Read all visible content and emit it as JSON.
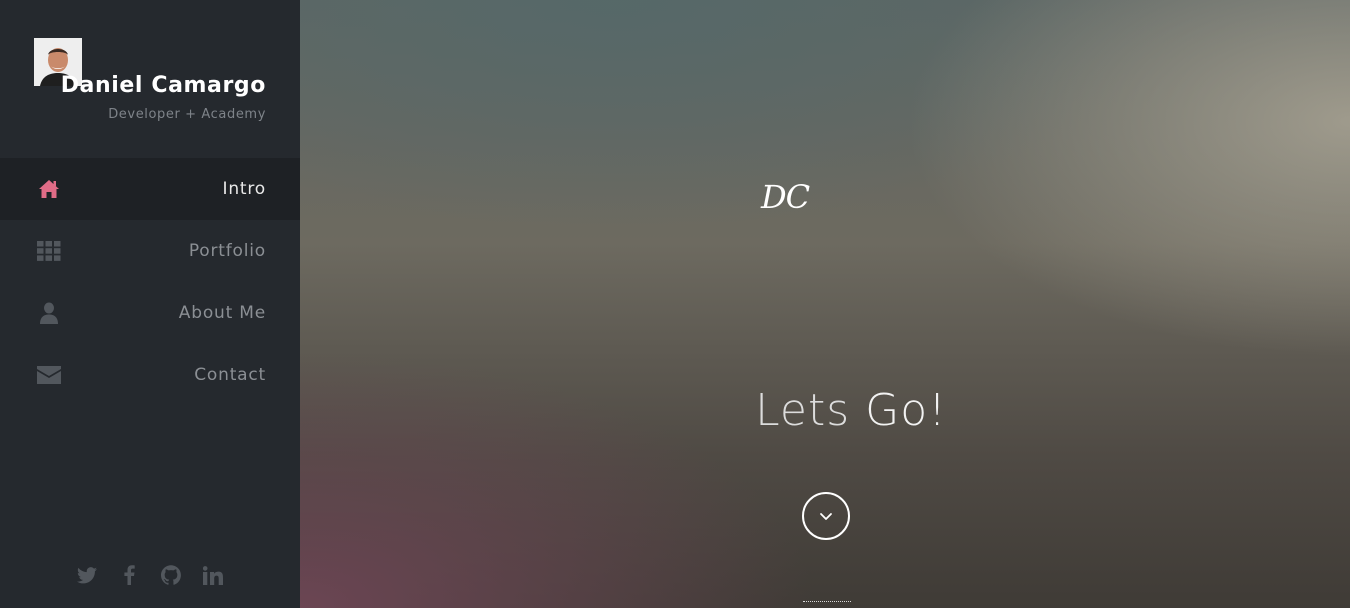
{
  "profile": {
    "name": "Daniel Camargo",
    "subtitle": "Developer + Academy",
    "avatar_icon": "person-photo"
  },
  "nav": {
    "items": [
      {
        "label": "Intro",
        "icon": "home-icon",
        "active": true
      },
      {
        "label": "Portfolio",
        "icon": "grid-icon",
        "active": false
      },
      {
        "label": "About Me",
        "icon": "user-icon",
        "active": false
      },
      {
        "label": "Contact",
        "icon": "envelope-icon",
        "active": false
      }
    ]
  },
  "social": {
    "items": [
      {
        "icon": "twitter-icon"
      },
      {
        "icon": "facebook-icon"
      },
      {
        "icon": "github-icon"
      },
      {
        "icon": "linkedin-icon"
      }
    ]
  },
  "hero": {
    "logo": "DC",
    "title_part1": "Lets",
    "title_part2": "Go!",
    "scroll_icon": "chevron-down-icon"
  },
  "colors": {
    "sidebar_bg": "#25292e",
    "active_item_bg": "#1e2125",
    "accent_pink": "#e06c87",
    "muted_icon": "#52575d"
  }
}
